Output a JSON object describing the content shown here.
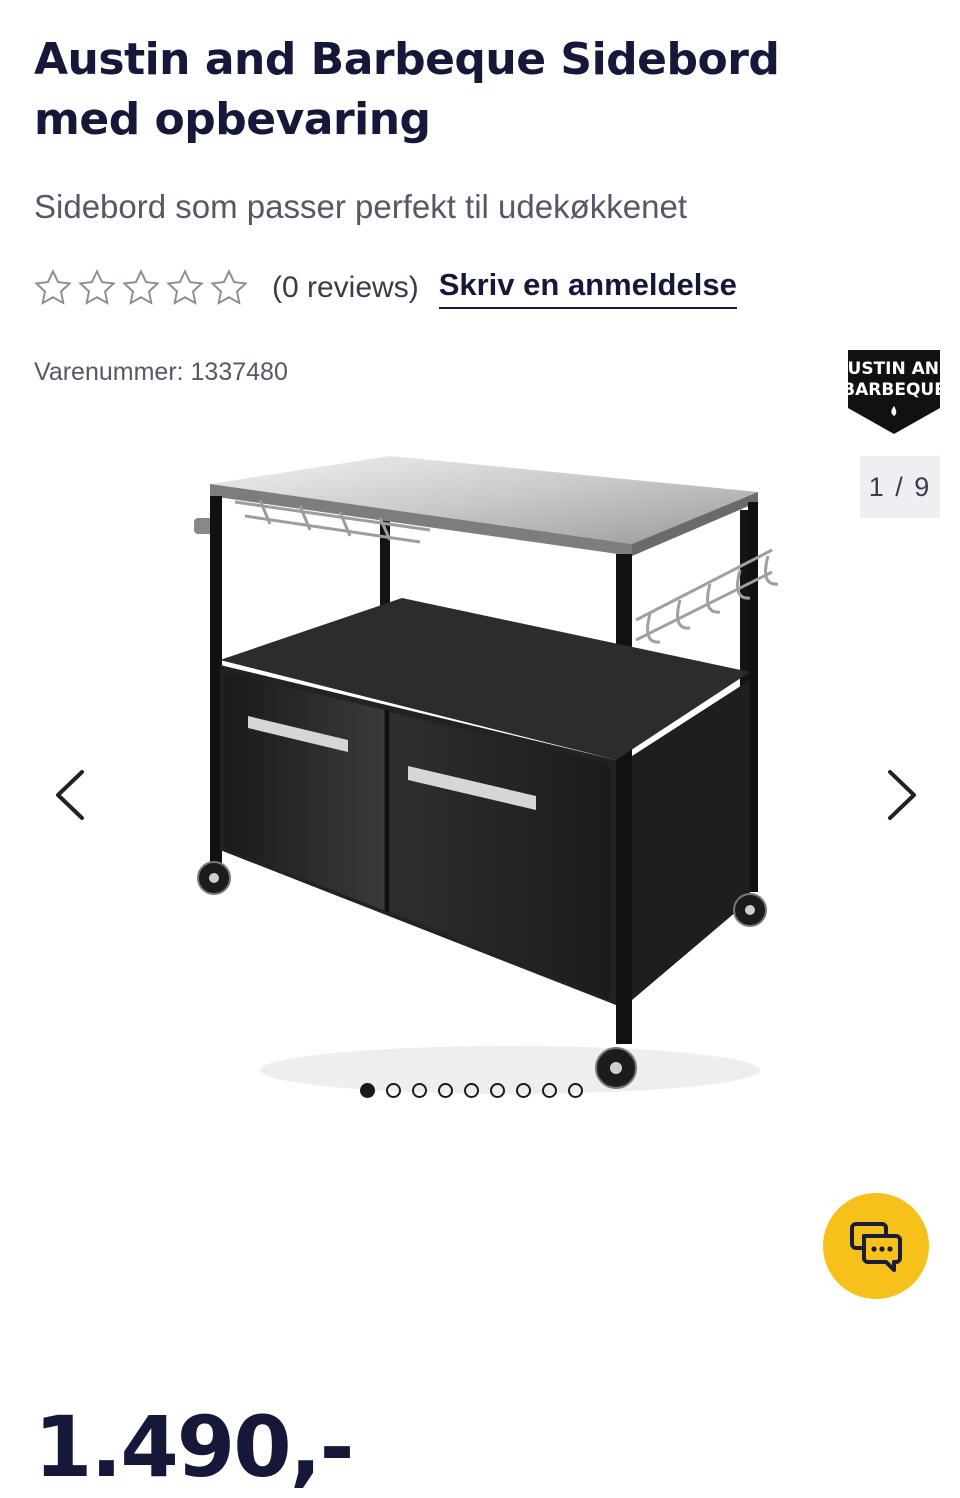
{
  "product": {
    "title": "Austin and Barbeque Sidebord med opbevaring",
    "subtitle": "Sidebord som passer perfekt til udekøkkenet",
    "rating": {
      "stars_filled": 0,
      "stars_total": 5,
      "reviews_text": "(0 reviews)"
    },
    "write_review_label": "Skriv en anmeldelse",
    "sku_text": "Varenummer: 1337480",
    "brand_logo_text": [
      "AUSTIN AND",
      "BARBEQUE"
    ],
    "price": "1.490,-"
  },
  "gallery": {
    "counter": "1 / 9",
    "current": 1,
    "total": 9,
    "prev_icon": "chevron-left-icon",
    "next_icon": "chevron-right-icon"
  },
  "chat": {
    "icon": "chat-bubbles-icon",
    "color": "#f5c11a"
  },
  "colors": {
    "text_dark": "#16183a",
    "accent": "#f5c11a",
    "muted": "#555866"
  }
}
